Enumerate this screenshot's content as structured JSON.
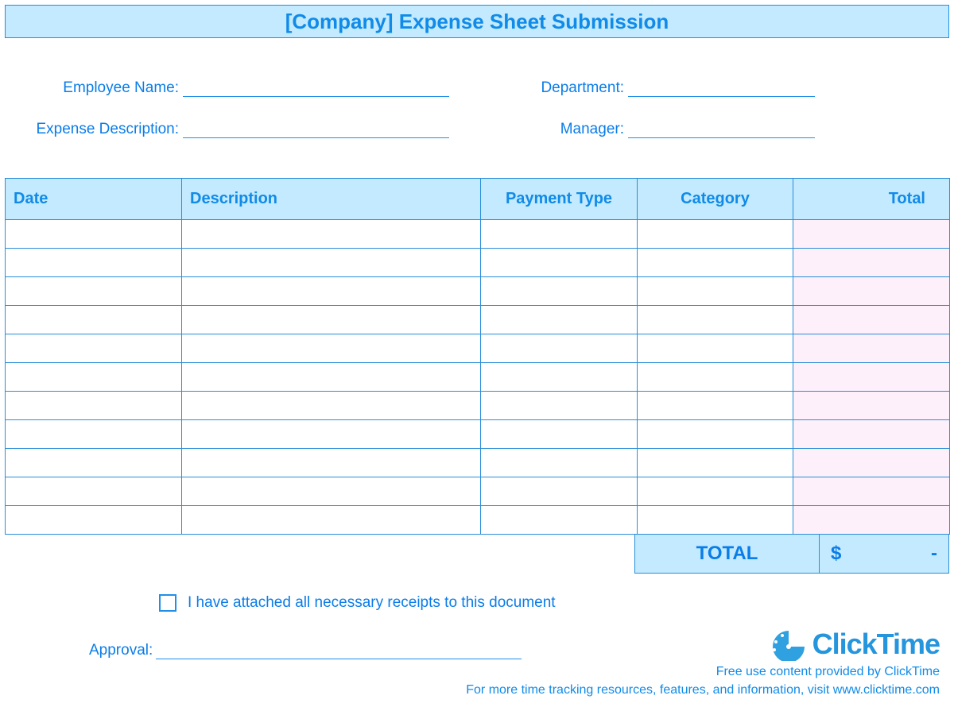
{
  "header": {
    "title": "[Company] Expense Sheet Submission"
  },
  "fields": {
    "employee_name_label": "Employee Name:",
    "department_label": "Department:",
    "expense_desc_label": "Expense Description:",
    "manager_label": "Manager:"
  },
  "table": {
    "headers": {
      "date": "Date",
      "description": "Description",
      "payment_type": "Payment Type",
      "category": "Category",
      "total": "Total"
    },
    "rows": 11
  },
  "totals": {
    "label": "TOTAL",
    "currency": "$",
    "value": "-"
  },
  "receipt": {
    "label": "I have attached all necessary receipts to this document"
  },
  "approval": {
    "label": "Approval:"
  },
  "branding": {
    "logo_text": "ClickTime"
  },
  "footer": {
    "line1": "Free use content provided by ClickTime",
    "line2": "For more time tracking resources, features, and information, visit www.clicktime.com"
  }
}
